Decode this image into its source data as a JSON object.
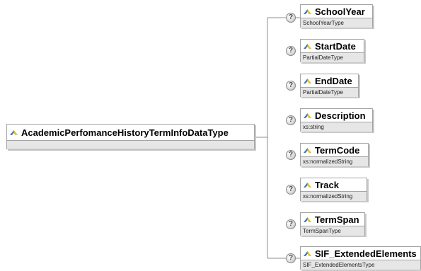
{
  "root": {
    "name": "AcademicPerfomanceHistoryTermInfoDataType"
  },
  "help_symbol": "?",
  "children": [
    {
      "name": "SchoolYear",
      "type": "SchoolYearType"
    },
    {
      "name": "StartDate",
      "type": "PartialDateType"
    },
    {
      "name": "EndDate",
      "type": "PartialDateType"
    },
    {
      "name": "Description",
      "type": "xs:string"
    },
    {
      "name": "TermCode",
      "type": "xs:normalizedString"
    },
    {
      "name": "Track",
      "type": "xs:normalizedString"
    },
    {
      "name": "TermSpan",
      "type": "TermSpanType"
    },
    {
      "name": "SIF_ExtendedElements",
      "type": "SIF_ExtendedElementsType"
    }
  ],
  "colors": {
    "line": "#8c8c8c",
    "border": "#a4a4a4",
    "type_band": "#e6e6e6",
    "icon_blue": "#3d78c6"
  }
}
